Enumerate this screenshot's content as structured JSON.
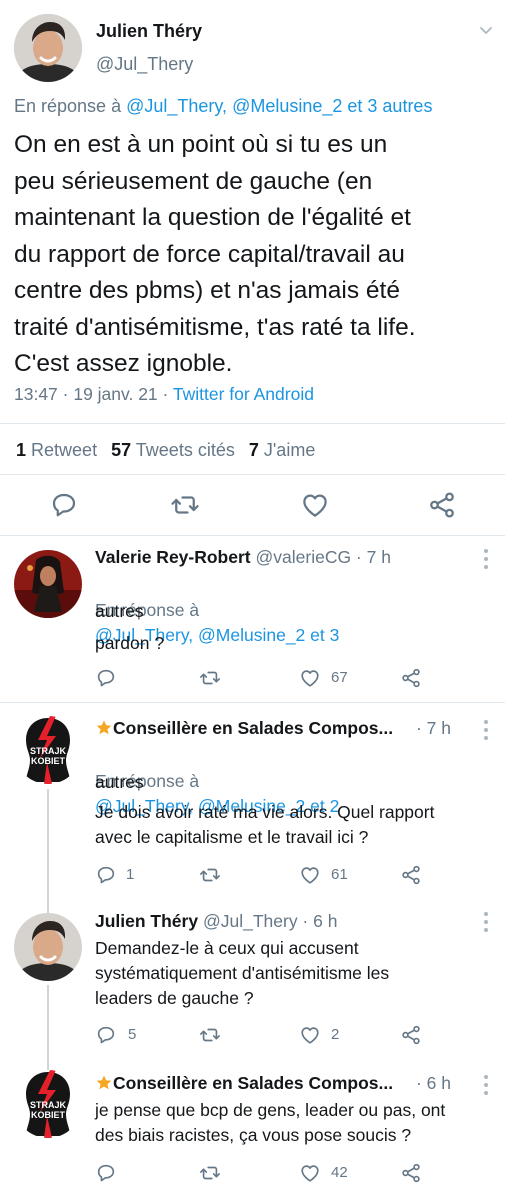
{
  "main_tweet": {
    "author_name": "Julien Théry",
    "author_handle": "@Jul_Thery",
    "reply_prefix": "En réponse à",
    "reply_targets": "@Jul_Thery, @Melusine_2 et 3 autres",
    "text": "On en est à un point où si tu es un\npeu sérieusement de gauche (en\nmaintenant la question de l'égalité et\ndu rapport de force capital/travail au\ncentre des pbms) et n'as jamais été\ntraité d'antisémitisme, t'as raté ta life.\nC'est assez ignoble.",
    "time": "13:47 · 19 janv. 21 ·",
    "source": "Twitter for Android",
    "stats": {
      "retweets_count": "1",
      "retweets_label": "Retweet",
      "quotes_count": "57",
      "quotes_label": "Tweets cités",
      "likes_count": "7",
      "likes_label": "J'aime"
    }
  },
  "replies": [
    {
      "author_name": "Valerie Rey-Robert",
      "author_handle": "@valerieCG · 7 h",
      "reply_line1_prefix": "En réponse à",
      "reply_line1_targets": "@Jul_Thery, @Melusine_2 et 3",
      "reply_line2": "autres",
      "text": "pardon ?",
      "reply_count": "",
      "like_count": "67"
    },
    {
      "author_name": "Conseillère en Salades Compos...",
      "author_handle": "· 7 h",
      "reply_line1_prefix": "En réponse à",
      "reply_line1_targets": "@Jul_Thery, @Melusine_2 et 2",
      "reply_line2": "autres",
      "text": "Je dois avoir raté ma vie alors. Quel rapport\navec le capitalisme et le travail ici ?",
      "reply_count": "1",
      "like_count": "61",
      "avatar_text_top": "STRAJK",
      "avatar_text_bottom": "KOBIET"
    },
    {
      "author_name": "Julien Théry",
      "author_handle": "@Jul_Thery · 6 h",
      "text": "Demandez-le à ceux qui accusent\nsystématiquement d'antisémitisme les\nleaders de gauche ?",
      "reply_count": "5",
      "like_count": "2"
    },
    {
      "author_name": "Conseillère en Salades Compos...",
      "author_handle": "· 6 h",
      "text": "je pense que bcp de gens, leader ou pas, ont\ndes biais racistes, ça vous pose soucis ?",
      "reply_count": "",
      "like_count": "42",
      "avatar_text_top": "STRAJK",
      "avatar_text_bottom": "KOBIET"
    }
  ],
  "colors": {
    "link_blue": "#1b95e0",
    "secondary_grey": "#657786",
    "strajk_red": "#e4202a"
  },
  "icons": [
    "chevron-down-icon",
    "reply-icon",
    "retweet-icon",
    "like-icon",
    "share-icon",
    "more-vertical-icon",
    "star-emoji-icon"
  ]
}
